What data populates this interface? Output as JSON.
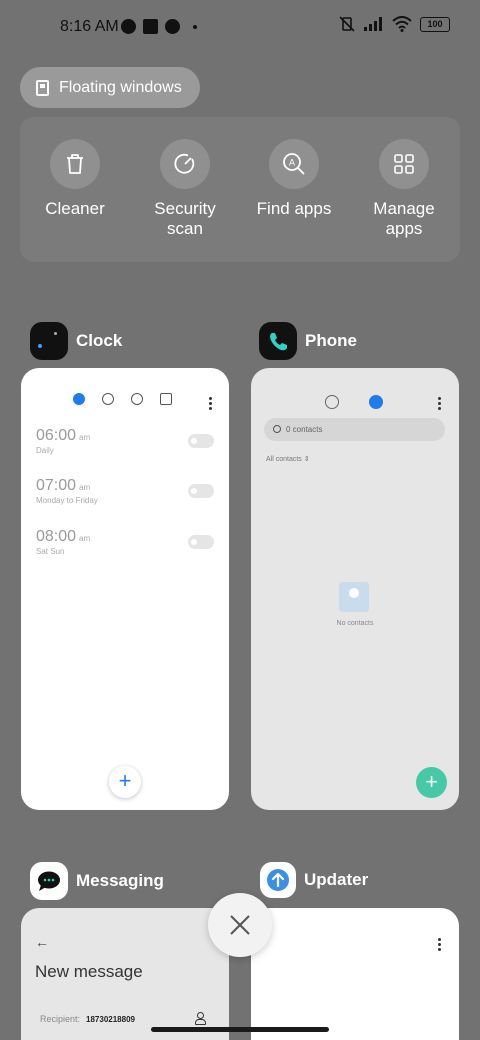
{
  "status_bar": {
    "time": "8:16 AM",
    "battery": "100"
  },
  "floating_windows": {
    "label": "Floating windows"
  },
  "quick_actions": [
    {
      "label": "Cleaner",
      "icon": "trash-icon"
    },
    {
      "label": "Security\nscan",
      "icon": "security-scan-icon"
    },
    {
      "label": "Find apps",
      "icon": "find-apps-icon"
    },
    {
      "label": "Manage\napps",
      "icon": "grid-icon"
    }
  ],
  "apps": {
    "clock": {
      "name": "Clock",
      "alarms": [
        {
          "time": "06:00",
          "ampm": "am",
          "repeat": "Daily"
        },
        {
          "time": "07:00",
          "ampm": "am",
          "repeat": "Monday to Friday"
        },
        {
          "time": "08:00",
          "ampm": "am",
          "repeat": "Sat Sun"
        }
      ],
      "fab": "+"
    },
    "phone": {
      "name": "Phone",
      "search_placeholder": "0 contacts",
      "filter": "All contacts",
      "empty_text": "No contacts",
      "fab": "+"
    },
    "messaging": {
      "name": "Messaging",
      "back": "←",
      "title": "New message",
      "recipient_label": "Recipient:",
      "recipient_value": "18730218809"
    },
    "updater": {
      "name": "Updater"
    }
  },
  "colors": {
    "background": "#727272",
    "accent_blue": "#1f7cea",
    "phone_fab": "#45c9a6"
  }
}
